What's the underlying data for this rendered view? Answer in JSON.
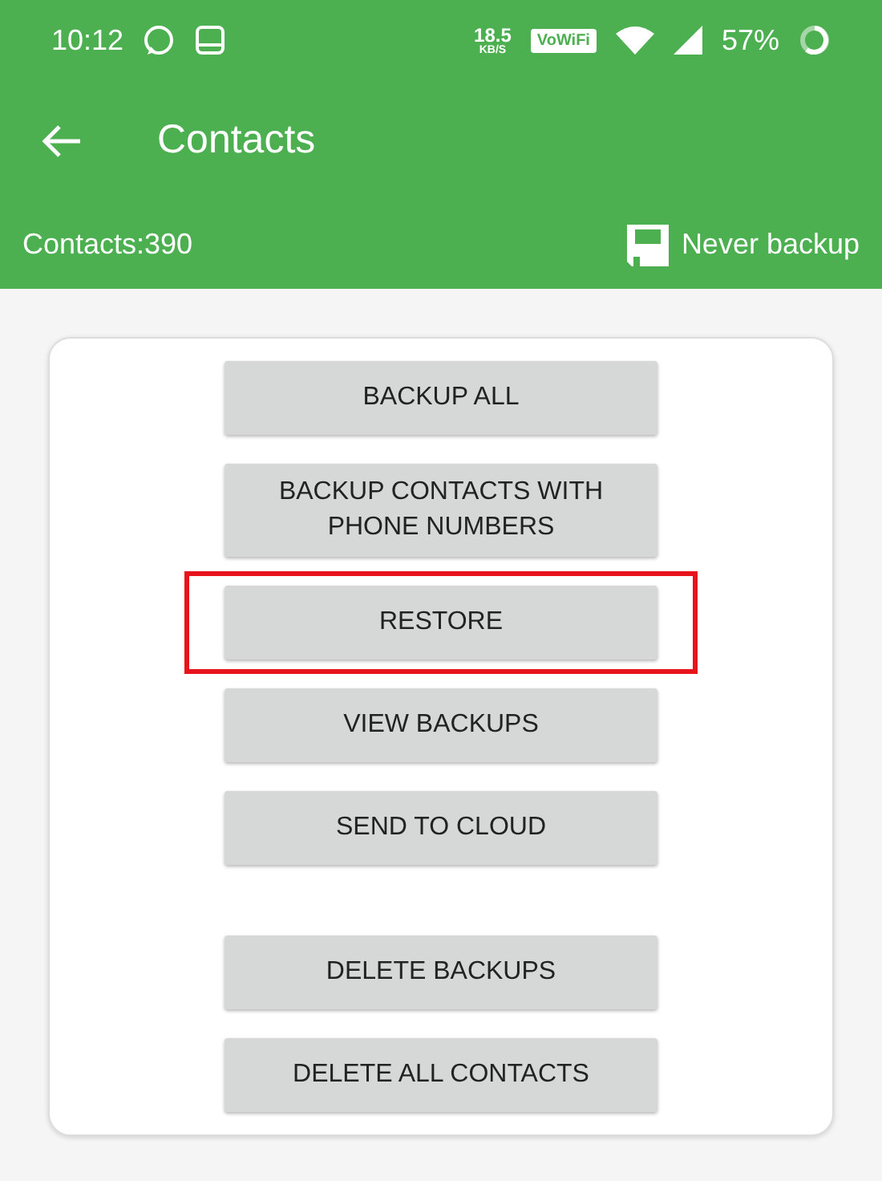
{
  "status_bar": {
    "time": "10:12",
    "speed_value": "18.5",
    "speed_unit": "KB/S",
    "vowifi": "VoWiFi",
    "battery": "57%"
  },
  "toolbar": {
    "title": "Contacts"
  },
  "summary": {
    "count": "Contacts:390",
    "backup_status": "Never backup"
  },
  "button_groups": [
    {
      "buttons": [
        {
          "label": "BACKUP ALL",
          "highlighted": false
        },
        {
          "label": "BACKUP CONTACTS WITH PHONE NUMBERS",
          "highlighted": false
        },
        {
          "label": "RESTORE",
          "highlighted": true
        },
        {
          "label": "VIEW BACKUPS",
          "highlighted": false
        },
        {
          "label": "SEND TO CLOUD",
          "highlighted": false
        }
      ]
    },
    {
      "buttons": [
        {
          "label": "DELETE BACKUPS",
          "highlighted": false
        },
        {
          "label": "DELETE ALL CONTACTS",
          "highlighted": false
        }
      ]
    }
  ]
}
